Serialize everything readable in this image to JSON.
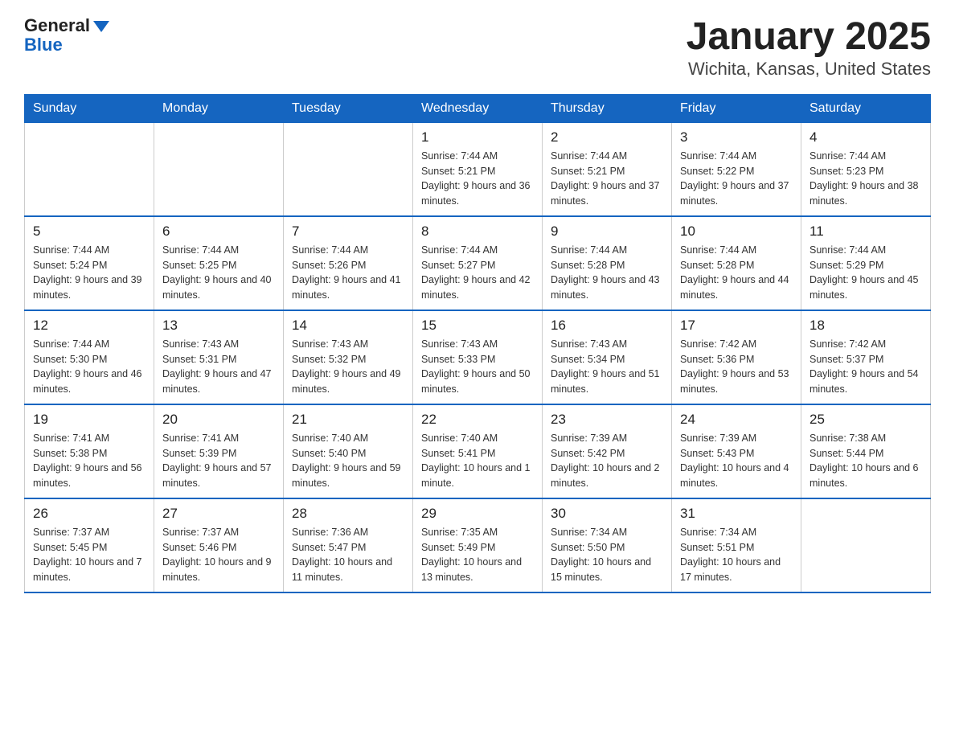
{
  "header": {
    "logo_general": "General",
    "logo_blue": "Blue",
    "title": "January 2025",
    "subtitle": "Wichita, Kansas, United States"
  },
  "days_of_week": [
    "Sunday",
    "Monday",
    "Tuesday",
    "Wednesday",
    "Thursday",
    "Friday",
    "Saturday"
  ],
  "weeks": [
    [
      {
        "day": "",
        "info": ""
      },
      {
        "day": "",
        "info": ""
      },
      {
        "day": "",
        "info": ""
      },
      {
        "day": "1",
        "info": "Sunrise: 7:44 AM\nSunset: 5:21 PM\nDaylight: 9 hours and 36 minutes."
      },
      {
        "day": "2",
        "info": "Sunrise: 7:44 AM\nSunset: 5:21 PM\nDaylight: 9 hours and 37 minutes."
      },
      {
        "day": "3",
        "info": "Sunrise: 7:44 AM\nSunset: 5:22 PM\nDaylight: 9 hours and 37 minutes."
      },
      {
        "day": "4",
        "info": "Sunrise: 7:44 AM\nSunset: 5:23 PM\nDaylight: 9 hours and 38 minutes."
      }
    ],
    [
      {
        "day": "5",
        "info": "Sunrise: 7:44 AM\nSunset: 5:24 PM\nDaylight: 9 hours and 39 minutes."
      },
      {
        "day": "6",
        "info": "Sunrise: 7:44 AM\nSunset: 5:25 PM\nDaylight: 9 hours and 40 minutes."
      },
      {
        "day": "7",
        "info": "Sunrise: 7:44 AM\nSunset: 5:26 PM\nDaylight: 9 hours and 41 minutes."
      },
      {
        "day": "8",
        "info": "Sunrise: 7:44 AM\nSunset: 5:27 PM\nDaylight: 9 hours and 42 minutes."
      },
      {
        "day": "9",
        "info": "Sunrise: 7:44 AM\nSunset: 5:28 PM\nDaylight: 9 hours and 43 minutes."
      },
      {
        "day": "10",
        "info": "Sunrise: 7:44 AM\nSunset: 5:28 PM\nDaylight: 9 hours and 44 minutes."
      },
      {
        "day": "11",
        "info": "Sunrise: 7:44 AM\nSunset: 5:29 PM\nDaylight: 9 hours and 45 minutes."
      }
    ],
    [
      {
        "day": "12",
        "info": "Sunrise: 7:44 AM\nSunset: 5:30 PM\nDaylight: 9 hours and 46 minutes."
      },
      {
        "day": "13",
        "info": "Sunrise: 7:43 AM\nSunset: 5:31 PM\nDaylight: 9 hours and 47 minutes."
      },
      {
        "day": "14",
        "info": "Sunrise: 7:43 AM\nSunset: 5:32 PM\nDaylight: 9 hours and 49 minutes."
      },
      {
        "day": "15",
        "info": "Sunrise: 7:43 AM\nSunset: 5:33 PM\nDaylight: 9 hours and 50 minutes."
      },
      {
        "day": "16",
        "info": "Sunrise: 7:43 AM\nSunset: 5:34 PM\nDaylight: 9 hours and 51 minutes."
      },
      {
        "day": "17",
        "info": "Sunrise: 7:42 AM\nSunset: 5:36 PM\nDaylight: 9 hours and 53 minutes."
      },
      {
        "day": "18",
        "info": "Sunrise: 7:42 AM\nSunset: 5:37 PM\nDaylight: 9 hours and 54 minutes."
      }
    ],
    [
      {
        "day": "19",
        "info": "Sunrise: 7:41 AM\nSunset: 5:38 PM\nDaylight: 9 hours and 56 minutes."
      },
      {
        "day": "20",
        "info": "Sunrise: 7:41 AM\nSunset: 5:39 PM\nDaylight: 9 hours and 57 minutes."
      },
      {
        "day": "21",
        "info": "Sunrise: 7:40 AM\nSunset: 5:40 PM\nDaylight: 9 hours and 59 minutes."
      },
      {
        "day": "22",
        "info": "Sunrise: 7:40 AM\nSunset: 5:41 PM\nDaylight: 10 hours and 1 minute."
      },
      {
        "day": "23",
        "info": "Sunrise: 7:39 AM\nSunset: 5:42 PM\nDaylight: 10 hours and 2 minutes."
      },
      {
        "day": "24",
        "info": "Sunrise: 7:39 AM\nSunset: 5:43 PM\nDaylight: 10 hours and 4 minutes."
      },
      {
        "day": "25",
        "info": "Sunrise: 7:38 AM\nSunset: 5:44 PM\nDaylight: 10 hours and 6 minutes."
      }
    ],
    [
      {
        "day": "26",
        "info": "Sunrise: 7:37 AM\nSunset: 5:45 PM\nDaylight: 10 hours and 7 minutes."
      },
      {
        "day": "27",
        "info": "Sunrise: 7:37 AM\nSunset: 5:46 PM\nDaylight: 10 hours and 9 minutes."
      },
      {
        "day": "28",
        "info": "Sunrise: 7:36 AM\nSunset: 5:47 PM\nDaylight: 10 hours and 11 minutes."
      },
      {
        "day": "29",
        "info": "Sunrise: 7:35 AM\nSunset: 5:49 PM\nDaylight: 10 hours and 13 minutes."
      },
      {
        "day": "30",
        "info": "Sunrise: 7:34 AM\nSunset: 5:50 PM\nDaylight: 10 hours and 15 minutes."
      },
      {
        "day": "31",
        "info": "Sunrise: 7:34 AM\nSunset: 5:51 PM\nDaylight: 10 hours and 17 minutes."
      },
      {
        "day": "",
        "info": ""
      }
    ]
  ]
}
